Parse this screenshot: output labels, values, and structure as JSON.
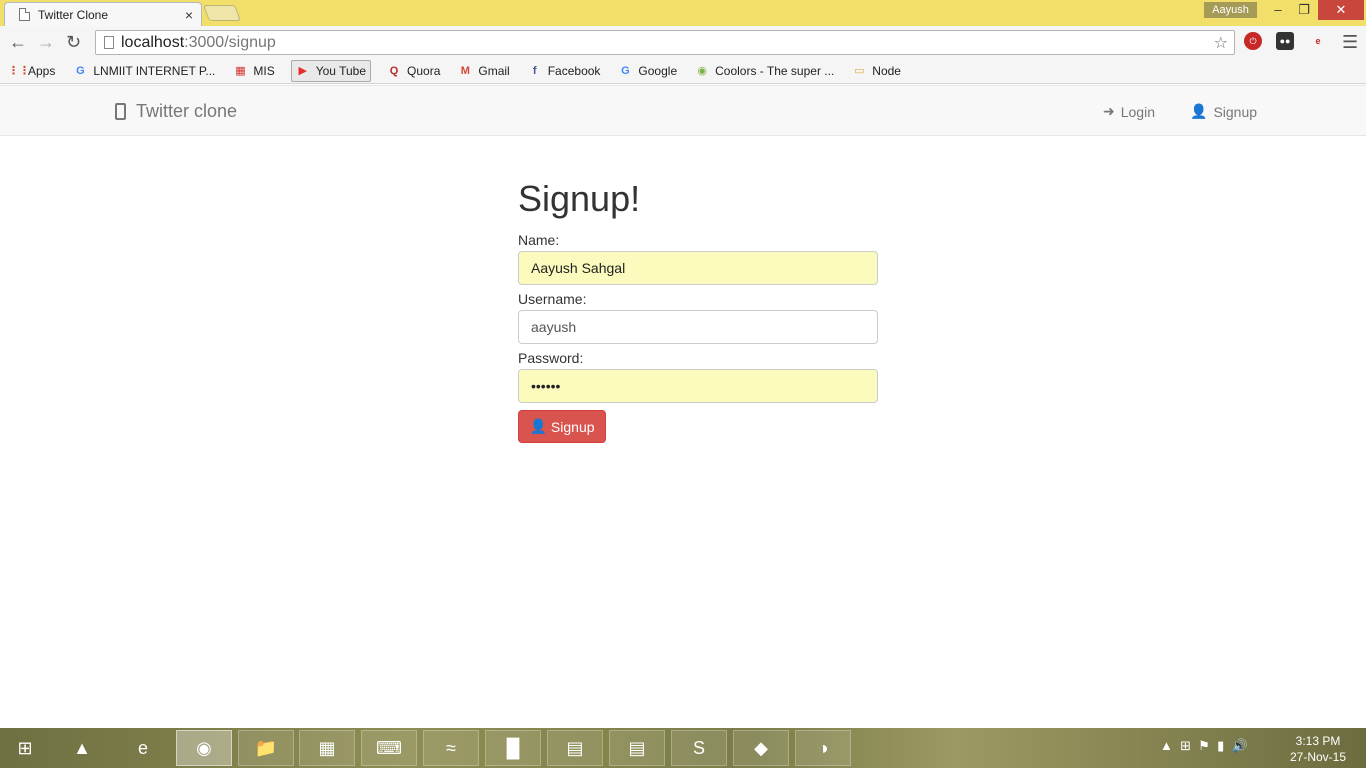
{
  "browser": {
    "tab_title": "Twitter Clone",
    "tab_close": "×",
    "user": "Aayush",
    "url_host": "localhost",
    "url_path": ":3000/signup",
    "window_controls": {
      "minimize": "–",
      "restore": "❐",
      "close": "✕"
    }
  },
  "bookmarks": [
    {
      "label": "Apps",
      "icon": "apps-grid-icon",
      "glyph": "⋮⋮"
    },
    {
      "label": "LNMIIT INTERNET P...",
      "icon": "google-icon",
      "glyph": "G"
    },
    {
      "label": "MIS",
      "icon": "mis-icon",
      "glyph": "▦"
    },
    {
      "label": "You Tube",
      "icon": "youtube-icon",
      "glyph": "▶"
    },
    {
      "label": "Quora",
      "icon": "quora-icon",
      "glyph": "Q"
    },
    {
      "label": "Gmail",
      "icon": "gmail-icon",
      "glyph": "M"
    },
    {
      "label": "Facebook",
      "icon": "facebook-icon",
      "glyph": "f"
    },
    {
      "label": "Google",
      "icon": "google-icon",
      "glyph": "G"
    },
    {
      "label": "Coolors - The super ...",
      "icon": "coolors-icon",
      "glyph": "◉"
    },
    {
      "label": "Node",
      "icon": "folder-icon",
      "glyph": "▭"
    }
  ],
  "navbar": {
    "brand": "Twitter clone",
    "login": "Login",
    "signup": "Signup"
  },
  "form": {
    "heading": "Signup!",
    "name_label": "Name:",
    "name_value": "Aayush Sahgal",
    "username_label": "Username:",
    "username_value": "aayush",
    "password_label": "Password:",
    "password_value": "••••••",
    "submit_label": "Signup"
  },
  "colors": {
    "accent_button": "#d9534f",
    "autofill_bg": "#fbfbbd",
    "titlebar": "#f2df6a"
  },
  "taskbar": {
    "time": "3:13 PM",
    "date": "27-Nov-15"
  }
}
